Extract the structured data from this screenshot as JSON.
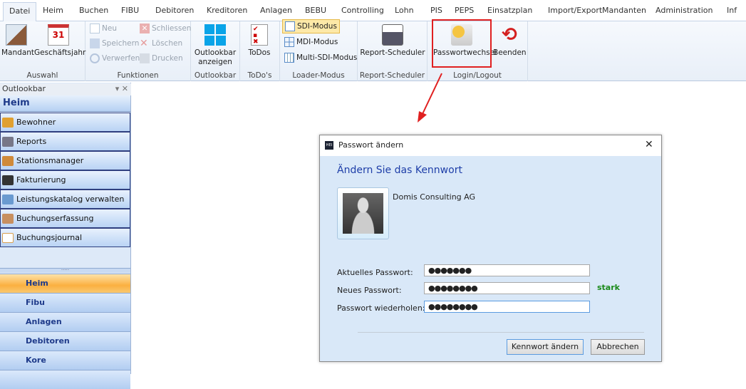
{
  "tabs": [
    "Datei",
    "Heim",
    "Buchen",
    "FIBU",
    "Debitoren",
    "Kreditoren",
    "Anlagen",
    "BEBU",
    "Controlling",
    "Lohn",
    "PIS",
    "PEPS",
    "Einsatzplan",
    "Import/Export",
    "Mandanten",
    "Administration",
    "Inf"
  ],
  "ribbon": {
    "auswahl": {
      "label": "Auswahl",
      "mandant": "Mandant",
      "geschaeftsjahr": "Geschäftsjahr",
      "calendar_day": "31"
    },
    "funktionen": {
      "label": "Funktionen",
      "neu": "Neu",
      "speichern": "Speichern",
      "verwerfen": "Verwerfen",
      "schliessen": "Schliessen",
      "loeschen": "Löschen",
      "drucken": "Drucken"
    },
    "outlookbar": {
      "label": "Outlookbar",
      "button_line1": "Outlookbar",
      "button_line2": "anzeigen"
    },
    "todos": {
      "label": "ToDo's",
      "button": "ToDos"
    },
    "loader": {
      "label": "Loader-Modus",
      "sdi": "SDI-Modus",
      "mdi": "MDI-Modus",
      "multi": "Multi-SDI-Modus"
    },
    "report": {
      "label": "Report-Scheduler",
      "button": "Report-Scheduler"
    },
    "login": {
      "label": "Login/Logout",
      "passwort": "Passwortwechsel",
      "beenden": "Beenden"
    }
  },
  "sidebar": {
    "title": "Outlookbar",
    "section": "Heim",
    "items": [
      "Bewohner",
      "Reports",
      "Stationsmanager",
      "Fakturierung",
      "Leistungskatalog verwalten",
      "Buchungserfassung",
      "Buchungsjournal"
    ],
    "nav": [
      "Heim",
      "Fibu",
      "Anlagen",
      "Debitoren",
      "Kore"
    ]
  },
  "dialog": {
    "app_icon": "HEI",
    "title": "Passwort ändern",
    "heading": "Ändern Sie das Kennwort",
    "company": "Domis Consulting AG",
    "current_label": "Aktuelles Passwort:",
    "current_value": "●●●●●●●",
    "new_label": "Neues Passwort:",
    "new_value": "●●●●●●●●",
    "strength": "stark",
    "repeat_label": "Passwort wiederholen:",
    "repeat_value": "●●●●●●●●",
    "submit": "Kennwort ändern",
    "cancel": "Abbrechen"
  },
  "colors": {
    "highlight": "#e02020",
    "strength": "#1a8a1a",
    "accent": "#1e3ea8"
  }
}
